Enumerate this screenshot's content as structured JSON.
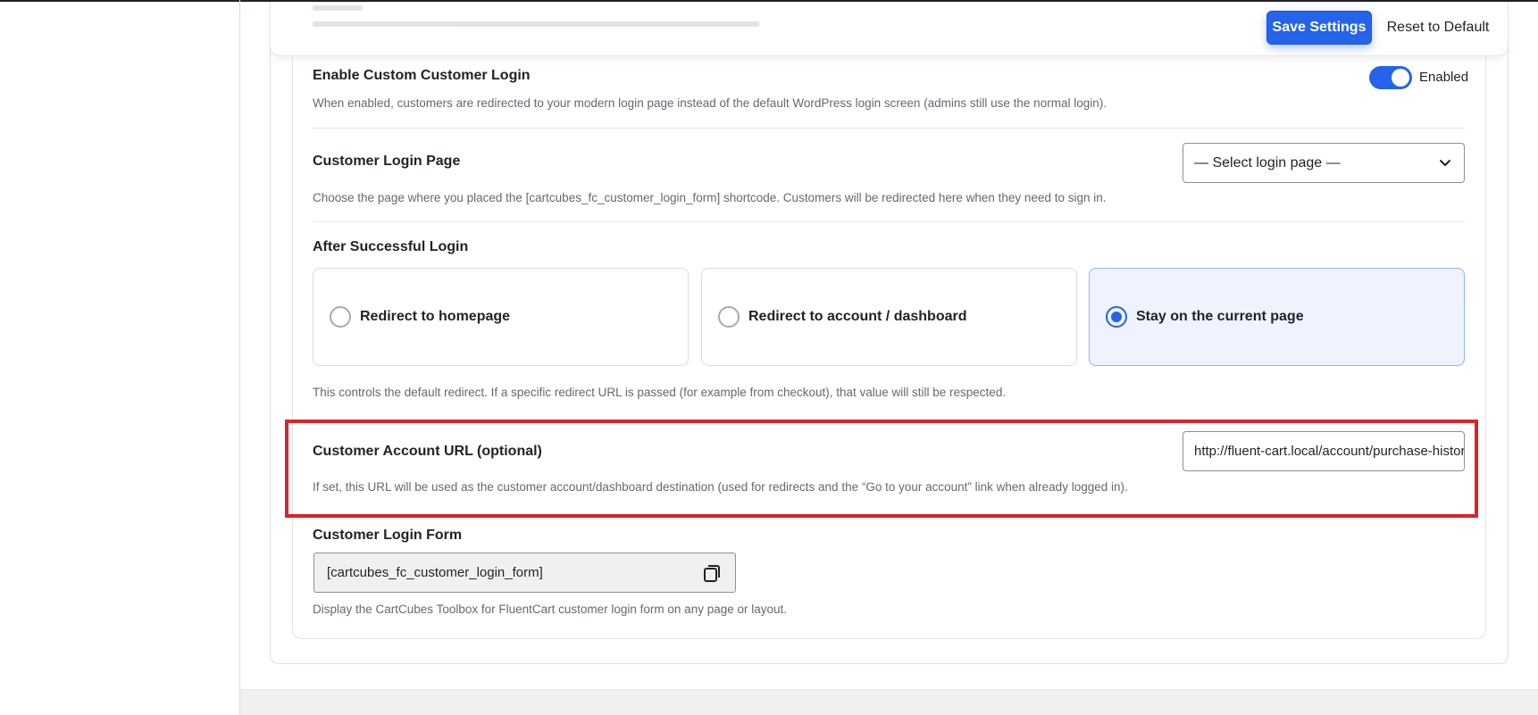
{
  "toolbar": {
    "save_label": "Save Settings",
    "reset_label": "Reset to Default"
  },
  "settings": {
    "custom_login": {
      "label": "Enable Custom Customer Login",
      "description": "When enabled, customers are redirected to your modern login page instead of the default WordPress login screen (admins still use the normal login).",
      "toggle_state": "Enabled",
      "enabled": true
    },
    "login_page": {
      "label": "Customer Login Page",
      "selected": "— Select login page —",
      "description": "Choose the page where you placed the [cartcubes_fc_customer_login_form] shortcode. Customers will be redirected here when they need to sign in."
    },
    "after_login": {
      "label": "After Successful Login",
      "options": [
        {
          "label": "Redirect to homepage",
          "checked": false
        },
        {
          "label": "Redirect to account / dashboard",
          "checked": false
        },
        {
          "label": "Stay on the current page",
          "checked": true
        }
      ],
      "description": "This controls the default redirect. If a specific redirect URL is passed (for example from checkout), that value will still be respected."
    },
    "account_url": {
      "label": "Customer Account URL (optional)",
      "value": "http://fluent-cart.local/account/purchase-history",
      "description": "If set, this URL will be used as the customer account/dashboard destination (used for redirects and the “Go to your account” link when already logged in)."
    },
    "login_form": {
      "label": "Customer Login Form",
      "shortcode": "[cartcubes_fc_customer_login_form]",
      "description": "Display the CartCubes Toolbox for FluentCart customer login form on any page or layout."
    }
  },
  "colors": {
    "accent": "#2563eb",
    "highlight": "#d9232d",
    "selected_card_bg": "#eef3fd"
  },
  "icons": {
    "chevron": "chevron-down-icon",
    "copy": "copy-icon"
  }
}
